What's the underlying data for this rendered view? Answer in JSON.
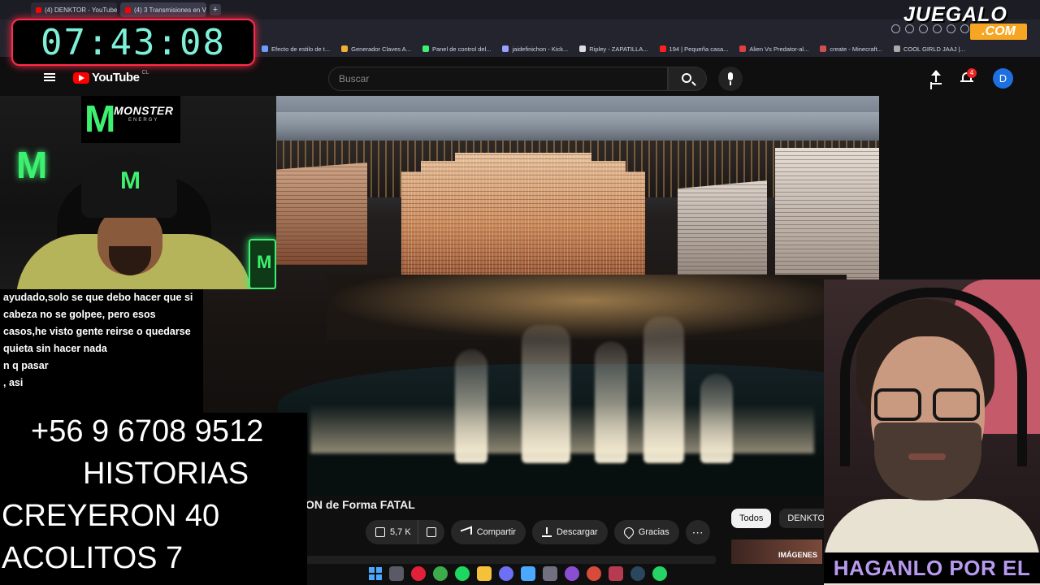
{
  "browser": {
    "tabs": [
      {
        "label": "(4) DENKTOR - YouTube",
        "active": false
      },
      {
        "label": "(4) 3 Transmisiones en Vi",
        "active": true
      }
    ],
    "new_tab_label": "+",
    "bookmarks": [
      {
        "label": "Efecto de estilo de t...",
        "color": "#6a9eff"
      },
      {
        "label": "Generador Claves A...",
        "color": "#f0b030"
      },
      {
        "label": "Panel de control del...",
        "color": "#3df070"
      },
      {
        "label": "jaidefinichon - Kick...",
        "color": "#9aa0ff"
      },
      {
        "label": "Ripley - ZAPATILLA...",
        "color": "#dddddd"
      },
      {
        "label": "194 | Pequeña casa...",
        "color": "#ff2020"
      },
      {
        "label": "Alien Vs Predator-al...",
        "color": "#e04040"
      },
      {
        "label": "create - Minecraft...",
        "color": "#d05050"
      },
      {
        "label": "COOL GIRLD JAAJ |...",
        "color": "#aaaaaa"
      }
    ]
  },
  "overlay": {
    "timer": "07:43:08",
    "juegalo_top": "JUEGALO",
    "juegalo_com": ".COM",
    "monster_name": "MONSTER",
    "monster_energy": "ENERGY",
    "phone": "+56 9 6708 9512",
    "historias": "HISTORIAS",
    "creyeron": "CREYERON 40",
    "acolitos": "ACOLITOS 7",
    "haganlo": "HAGANLO POR EL"
  },
  "chat": {
    "messages": [
      "ayudado,solo se que debo hacer que si",
      "cabeza no se golpee, pero esos",
      "casos,he visto gente reirse o quedarse",
      "quieta sin hacer nada",
      "n q pasar",
      ", asi"
    ]
  },
  "youtube": {
    "logo_text": "YouTube",
    "country": "CL",
    "search_placeholder": "Buscar",
    "notif_count": "4",
    "avatar_letter": "D",
    "video_title": "ON de Forma FATAL",
    "actions": {
      "likes": "5,7 K",
      "share": "Compartir",
      "download": "Descargar",
      "thanks": "Gracias",
      "more": "⋯"
    },
    "chips": [
      {
        "label": "Todos",
        "active": true
      },
      {
        "label": "DENKTOR",
        "active": false
      }
    ],
    "next_thumb_text": "IMÁGENES"
  },
  "taskbar": {
    "icons": [
      "windows-start",
      "task-view",
      "opera-gx",
      "xbox",
      "spotify",
      "files",
      "discord",
      "photos",
      "calculator",
      "obs",
      "chrome",
      "steam",
      "another-app",
      "whatsapp"
    ]
  },
  "colors": {
    "accent_red": "#ff0000",
    "timer_border": "#ff2b4a",
    "timer_digits": "#7ff0d8",
    "monster_green": "#3df070",
    "haganlo_purple": "#b79af0",
    "juegalo_orange": "#f6a623"
  }
}
